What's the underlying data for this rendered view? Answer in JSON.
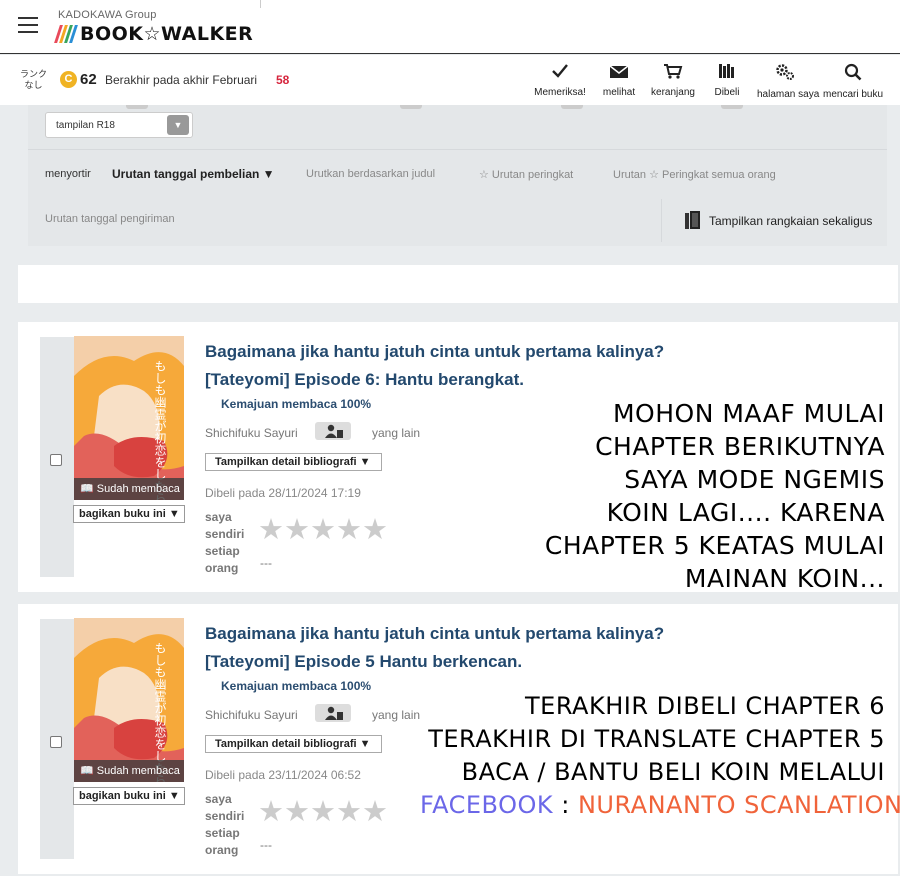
{
  "header": {
    "group": "KADOKAWA Group",
    "brand": "BOOK☆WALKER",
    "brand_colors": [
      "#e94a5b",
      "#f5a623",
      "#3aa55d",
      "#2a8fd6"
    ]
  },
  "account": {
    "rank_line1": "ランク",
    "rank_line2": "なし",
    "coin_symbol": "C",
    "coins": "62",
    "expire_text": "Berakhir pada akhir Februari",
    "expire_count": "58"
  },
  "nav": [
    {
      "label": "Memeriksa!",
      "icon": "check-icon"
    },
    {
      "label": "melihat",
      "icon": "mail-icon"
    },
    {
      "label": "keranjang",
      "icon": "cart-icon"
    },
    {
      "label": "Dibeli",
      "icon": "library-icon"
    },
    {
      "label": "halaman saya",
      "icon": "gears-icon"
    },
    {
      "label": "mencari buku",
      "icon": "search-icon"
    }
  ],
  "filters": {
    "r18_label": "tampilan R18",
    "sort_label": "menyortir",
    "sort_options": [
      "Urutan tanggal pembelian ▼",
      "Urutkan berdasarkan judul",
      "☆ Urutan peringkat",
      "Urutan ☆ Peringkat semua orang"
    ],
    "ship_sort": "Urutan tanggal pengiriman",
    "series_button": "Tampilkan rangkaian sekaligus"
  },
  "books": [
    {
      "title": "Bagaimana jika hantu jatuh cinta untuk pertama kalinya? [Tateyomi] Episode 6: Hantu berangkat.",
      "progress": "Kemajuan membaca 100%",
      "author": "Shichifuku Sayuri",
      "others": "yang lain",
      "biblio": "Tampilkan detail bibliografi ▼",
      "badge": "📖 Sudah membaca",
      "share": "bagikan buku ini ▼",
      "bought": "Dibeli pada 28/11/2024 17:19",
      "rating_label": "saya sendiri setiap orang",
      "rating_value": "---",
      "cover_title": "もしも幽霊が初恋をしたら"
    },
    {
      "title": "Bagaimana jika hantu jatuh cinta untuk pertama kalinya? [Tateyomi] Episode 5 Hantu berkencan.",
      "progress": "Kemajuan membaca 100%",
      "author": "Shichifuku Sayuri",
      "others": "yang lain",
      "biblio": "Tampilkan detail bibliografi ▼",
      "badge": "📖 Sudah membaca",
      "share": "bagikan buku ini ▼",
      "bought": "Dibeli pada 23/11/2024 06:52",
      "rating_label": "saya sendiri setiap orang",
      "rating_value": "---",
      "cover_title": "もしも幽霊が初恋をしたら"
    }
  ],
  "overlay_note_1": [
    "MOHON MAAF MULAI",
    "CHAPTER  BERIKUTNYA",
    "SAYA MODE NGEMIS",
    "KOIN LAGI.... KARENA",
    "CHAPTER 5 KEATAS MULAI",
    "MAINAN KOIN..."
  ],
  "overlay_note_2": {
    "lines": [
      "TERAKHIR DIBELI CHAPTER 6",
      "TERAKHIR DI TRANSLATE CHAPTER 5",
      "BACA / BANTU BELI KOIN MELALUI"
    ],
    "facebook": "FACEBOOK",
    "separator": " : ",
    "page": "NURANANTO SCANLATION"
  }
}
